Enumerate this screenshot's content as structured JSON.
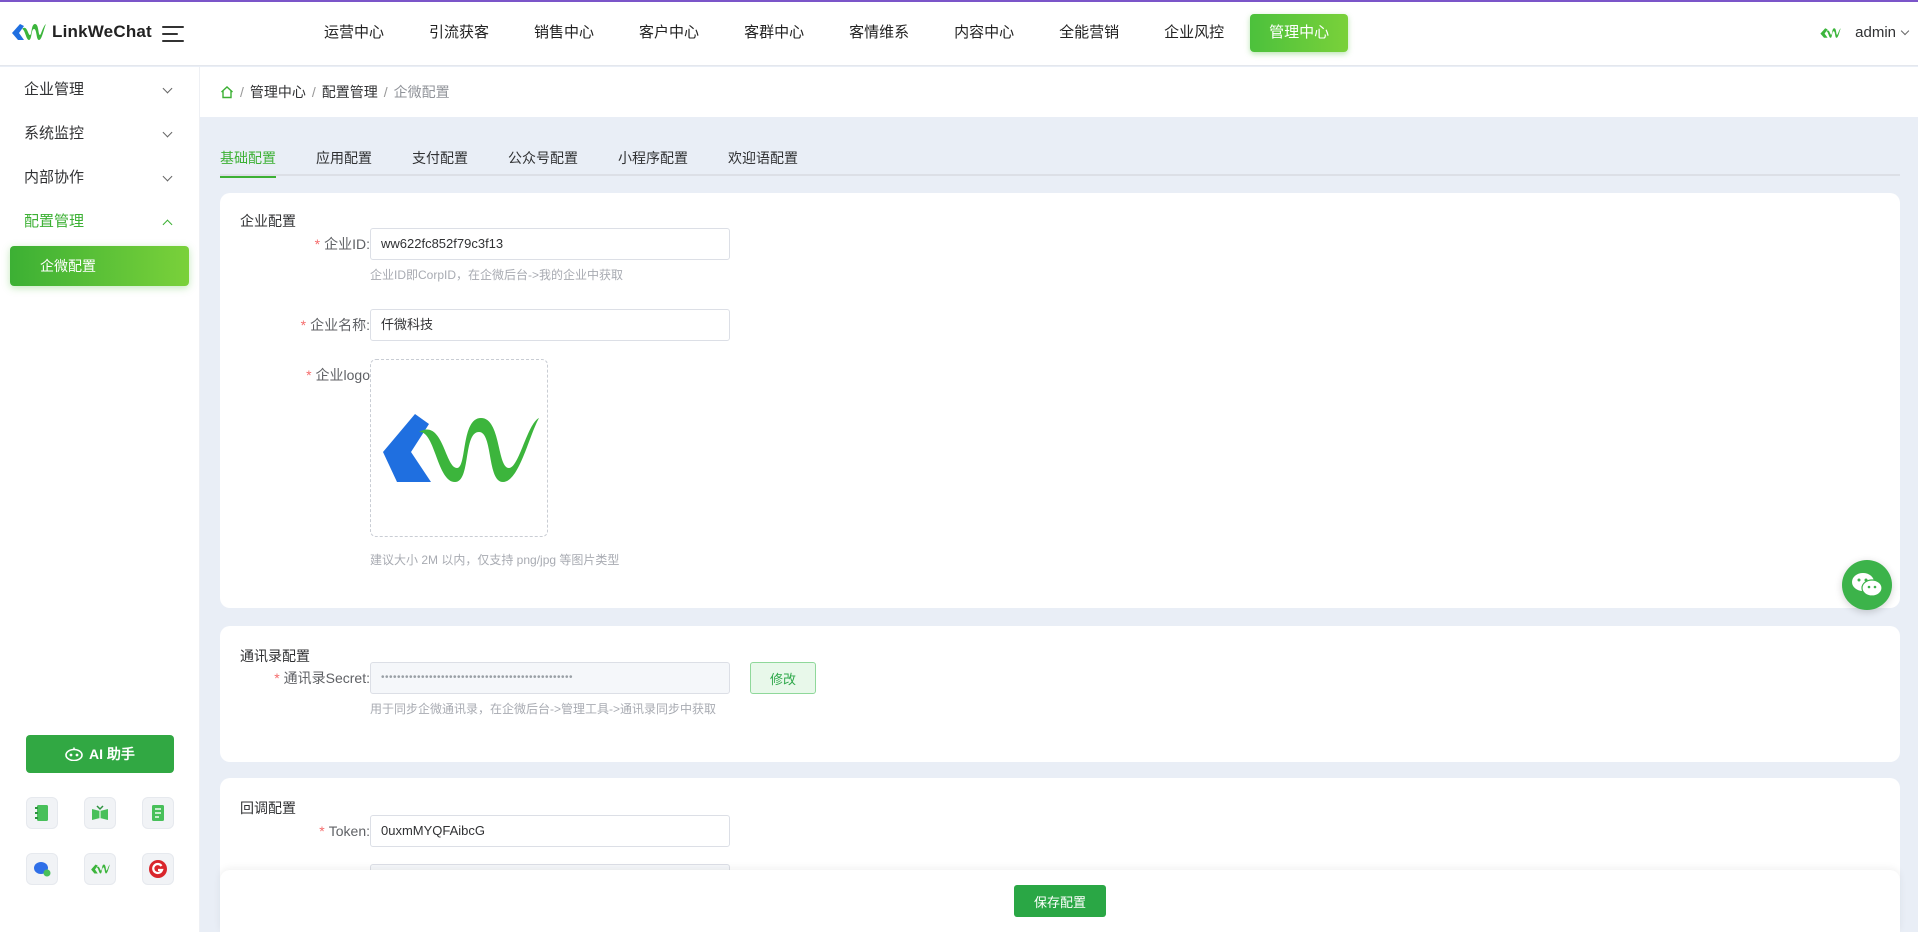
{
  "header": {
    "app_name": "LinkWeChat",
    "nav": [
      "运营中心",
      "引流获客",
      "销售中心",
      "客户中心",
      "客群中心",
      "客情维系",
      "内容中心",
      "全能营销",
      "企业风控",
      "管理中心"
    ],
    "active_nav": "管理中心",
    "user": "admin"
  },
  "sidebar": {
    "items": [
      {
        "label": "企业管理",
        "open": false
      },
      {
        "label": "系统监控",
        "open": false
      },
      {
        "label": "内部协作",
        "open": false
      },
      {
        "label": "配置管理",
        "open": true
      }
    ],
    "active_sub": "企微配置",
    "ai_button": "AI 助手",
    "tools": [
      "notebook-icon",
      "book-icon",
      "document-icon",
      "chat-bot-icon",
      "linkwechat-logo-icon",
      "g-logo-icon"
    ]
  },
  "breadcrumb": [
    "管理中心",
    "配置管理",
    "企微配置"
  ],
  "tabs": [
    "基础配置",
    "应用配置",
    "支付配置",
    "公众号配置",
    "小程序配置",
    "欢迎语配置"
  ],
  "active_tab": "基础配置",
  "enterprise": {
    "title": "企业配置",
    "corp_id_label": "企业ID:",
    "corp_id_value": "ww622fc852f79c3f13",
    "corp_id_hint": "企业ID即CorpID，在企微后台->我的企业中获取",
    "corp_name_label": "企业名称:",
    "corp_name_value": "仟微科技",
    "logo_label": "企业logo",
    "logo_hint": "建议大小 2M 以内，仅支持 png/jpg 等图片类型"
  },
  "contacts": {
    "title": "通讯录配置",
    "secret_label": "通讯录Secret:",
    "secret_value": "••••••••••••••••••••••••••••••••••••••••••••••••",
    "modify_label": "修改",
    "hint": "用于同步企微通讯录，在企微后台->管理工具->通讯录同步中获取"
  },
  "callback": {
    "title": "回调配置",
    "token_label": "Token:",
    "token_value": "0uxmMYQFAibcG"
  },
  "save_label": "保存配置",
  "colors": {
    "primary": "#3cb034",
    "accent_line": "#7b55c9",
    "logo_blue": "#1f6fe0",
    "logo_green": "#3cb53c"
  }
}
